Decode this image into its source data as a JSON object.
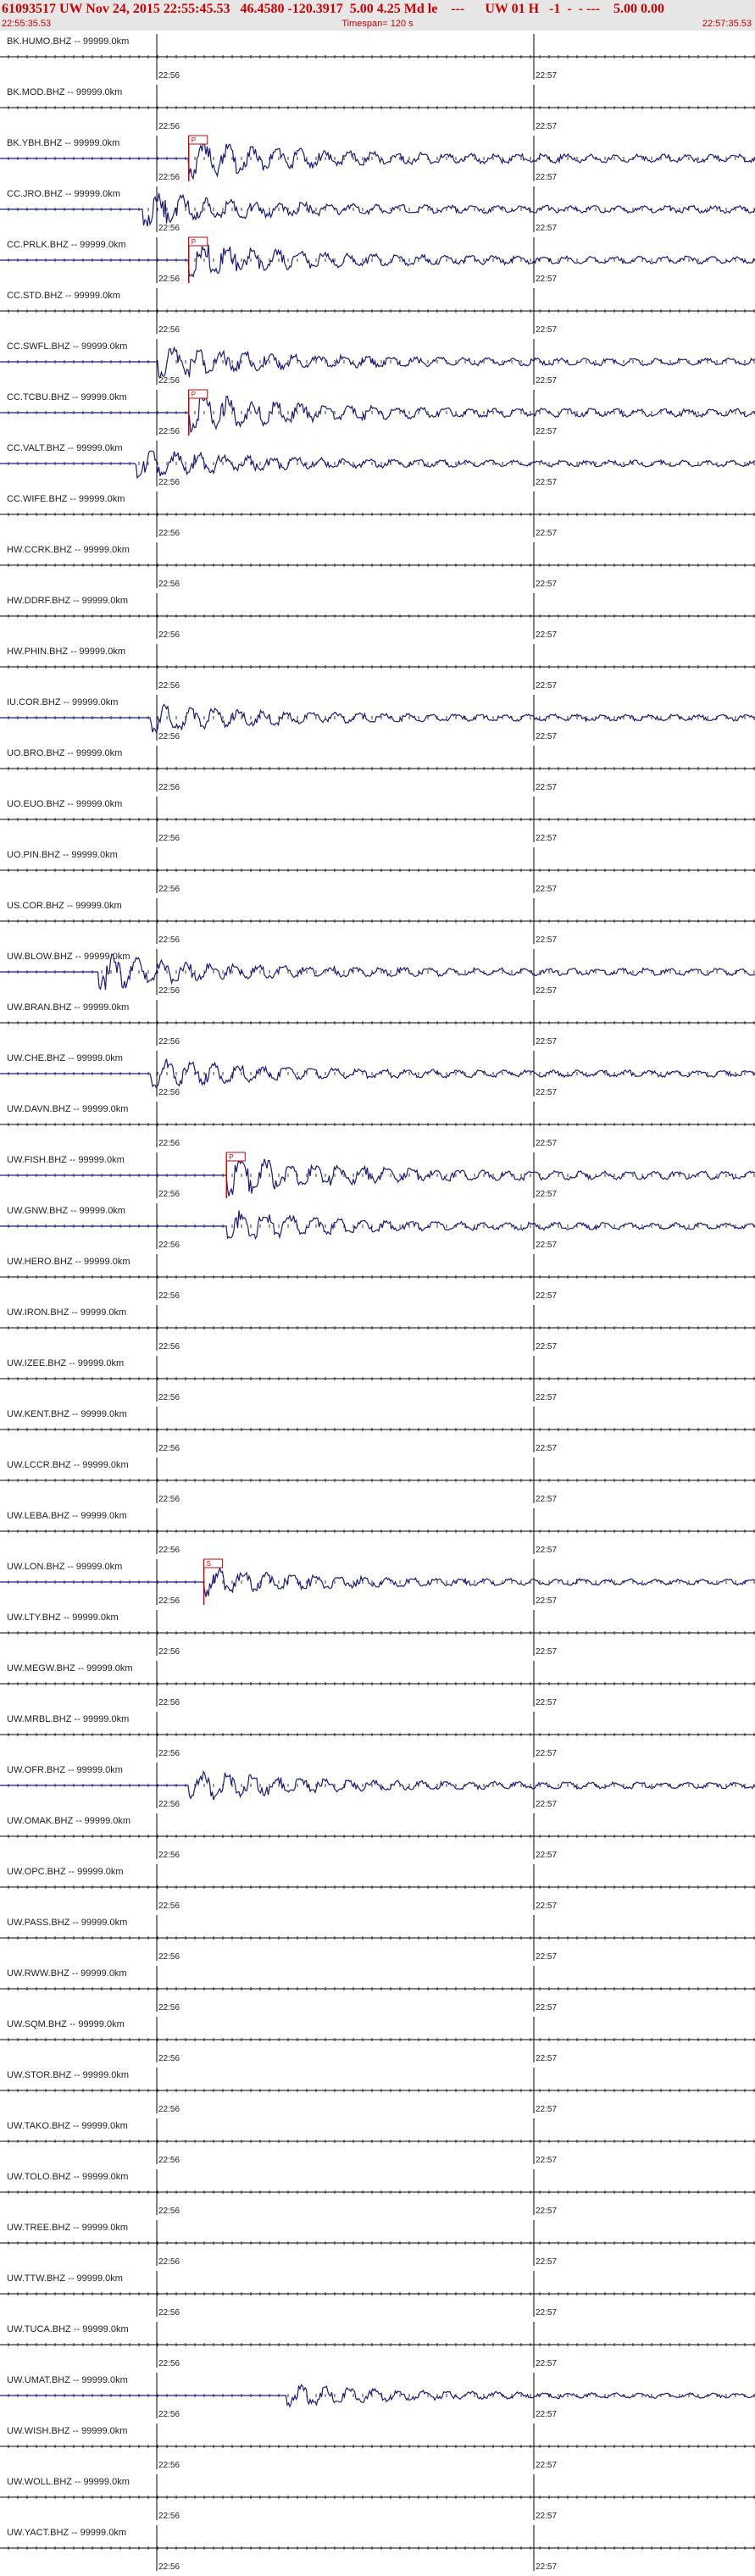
{
  "header": {
    "title": "61093517 UW Nov 24, 2015 22:55:45.53   46.4580 -120.3917  5.00 4.25 Md le    ---      UW 01 H   -1  -  - ---    5.00 0.00",
    "start_time": "22:55:35.53",
    "timespan": "Timespan= 120 s",
    "end_time": "22:57:35.53"
  },
  "colors": {
    "header_text": "#cc0000",
    "trace": "#1a1a7a",
    "axis": "#000000",
    "pick": "#cc0000",
    "header_bg": "#e6e6e6"
  },
  "chart_data": {
    "type": "line",
    "x_label_times": [
      "22:56",
      "22:57"
    ],
    "channels": [
      {
        "name": "BK.HUMO.BHZ -- 99999.0km",
        "amp": 0
      },
      {
        "name": "BK.MOD.BHZ -- 99999.0km",
        "amp": 0
      },
      {
        "name": "BK.YBH.BHZ -- 99999.0km",
        "amp": 1.0,
        "onset": 0.25,
        "pick": "P"
      },
      {
        "name": "CC.JRO.BHZ -- 99999.0km",
        "amp": 0.9,
        "onset": 0.19
      },
      {
        "name": "CC.PRLK.BHZ -- 99999.0km",
        "amp": 0.9,
        "onset": 0.25,
        "pick": "P"
      },
      {
        "name": "CC.STD.BHZ -- 99999.0km",
        "amp": 0
      },
      {
        "name": "CC.SWFL.BHZ -- 99999.0km",
        "amp": 0.9,
        "onset": 0.21
      },
      {
        "name": "CC.TCBU.BHZ -- 99999.0km",
        "amp": 1.0,
        "onset": 0.25,
        "pick": "P"
      },
      {
        "name": "CC.VALT.BHZ -- 99999.0km",
        "amp": 0.8,
        "onset": 0.18
      },
      {
        "name": "CC.WIFE.BHZ -- 99999.0km",
        "amp": 0
      },
      {
        "name": "HW.CCRK.BHZ -- 99999.0km",
        "amp": 0
      },
      {
        "name": "HW.DDRF.BHZ -- 99999.0km",
        "amp": 0
      },
      {
        "name": "HW.PHIN.BHZ -- 99999.0km",
        "amp": 0
      },
      {
        "name": "IU.COR.BHZ -- 99999.0km",
        "amp": 0.8,
        "onset": 0.2
      },
      {
        "name": "UO.BRO.BHZ -- 99999.0km",
        "amp": 0
      },
      {
        "name": "UO.EUO.BHZ -- 99999.0km",
        "amp": 0
      },
      {
        "name": "UO.PIN.BHZ -- 99999.0km",
        "amp": 0
      },
      {
        "name": "US.COR.BHZ -- 99999.0km",
        "amp": 0
      },
      {
        "name": "UW.BLOW.BHZ -- 99999.0km",
        "amp": 0.9,
        "onset": 0.13
      },
      {
        "name": "UW.BRAN.BHZ -- 99999.0km",
        "amp": 0
      },
      {
        "name": "UW.CHE.BHZ -- 99999.0km",
        "amp": 0.8,
        "onset": 0.2
      },
      {
        "name": "UW.DAVN.BHZ -- 99999.0km",
        "amp": 0
      },
      {
        "name": "UW.FISH.BHZ -- 99999.0km",
        "amp": 1.0,
        "onset": 0.3,
        "pick": "P"
      },
      {
        "name": "UW.GNW.BHZ -- 99999.0km",
        "amp": 0.8,
        "onset": 0.3
      },
      {
        "name": "UW.HERO.BHZ -- 99999.0km",
        "amp": 0
      },
      {
        "name": "UW.IRON.BHZ -- 99999.0km",
        "amp": 0
      },
      {
        "name": "UW.IZEE.BHZ -- 99999.0km",
        "amp": 0
      },
      {
        "name": "UW.KENT.BHZ -- 99999.0km",
        "amp": 0
      },
      {
        "name": "UW.LCCR.BHZ -- 99999.0km",
        "amp": 0
      },
      {
        "name": "UW.LEBA.BHZ -- 99999.0km",
        "amp": 0
      },
      {
        "name": "UW.LON.BHZ -- 99999.0km",
        "amp": 0.7,
        "onset": 0.27,
        "pick": "S"
      },
      {
        "name": "UW.LTY.BHZ -- 99999.0km",
        "amp": 0
      },
      {
        "name": "UW.MEGW.BHZ -- 99999.0km",
        "amp": 0
      },
      {
        "name": "UW.MRBL.BHZ -- 99999.0km",
        "amp": 0
      },
      {
        "name": "UW.OFR.BHZ -- 99999.0km",
        "amp": 0.8,
        "onset": 0.25
      },
      {
        "name": "UW.OMAK.BHZ -- 99999.0km",
        "amp": 0
      },
      {
        "name": "UW.OPC.BHZ -- 99999.0km",
        "amp": 0
      },
      {
        "name": "UW.PASS.BHZ -- 99999.0km",
        "amp": 0
      },
      {
        "name": "UW.RWW.BHZ -- 99999.0km",
        "amp": 0
      },
      {
        "name": "UW.SQM.BHZ -- 99999.0km",
        "amp": 0
      },
      {
        "name": "UW.STOR.BHZ -- 99999.0km",
        "amp": 0
      },
      {
        "name": "UW.TAKO.BHZ -- 99999.0km",
        "amp": 0
      },
      {
        "name": "UW.TOLO.BHZ -- 99999.0km",
        "amp": 0
      },
      {
        "name": "UW.TREE.BHZ -- 99999.0km",
        "amp": 0
      },
      {
        "name": "UW.TTW.BHZ -- 99999.0km",
        "amp": 0
      },
      {
        "name": "UW.TUCA.BHZ -- 99999.0km",
        "amp": 0
      },
      {
        "name": "UW.UMAT.BHZ -- 99999.0km",
        "amp": 0.6,
        "onset": 0.38
      },
      {
        "name": "UW.WISH.BHZ -- 99999.0km",
        "amp": 0
      },
      {
        "name": "UW.WOLL.BHZ -- 99999.0km",
        "amp": 0
      },
      {
        "name": "UW.YACT.BHZ -- 99999.0km",
        "amp": 0
      }
    ]
  }
}
